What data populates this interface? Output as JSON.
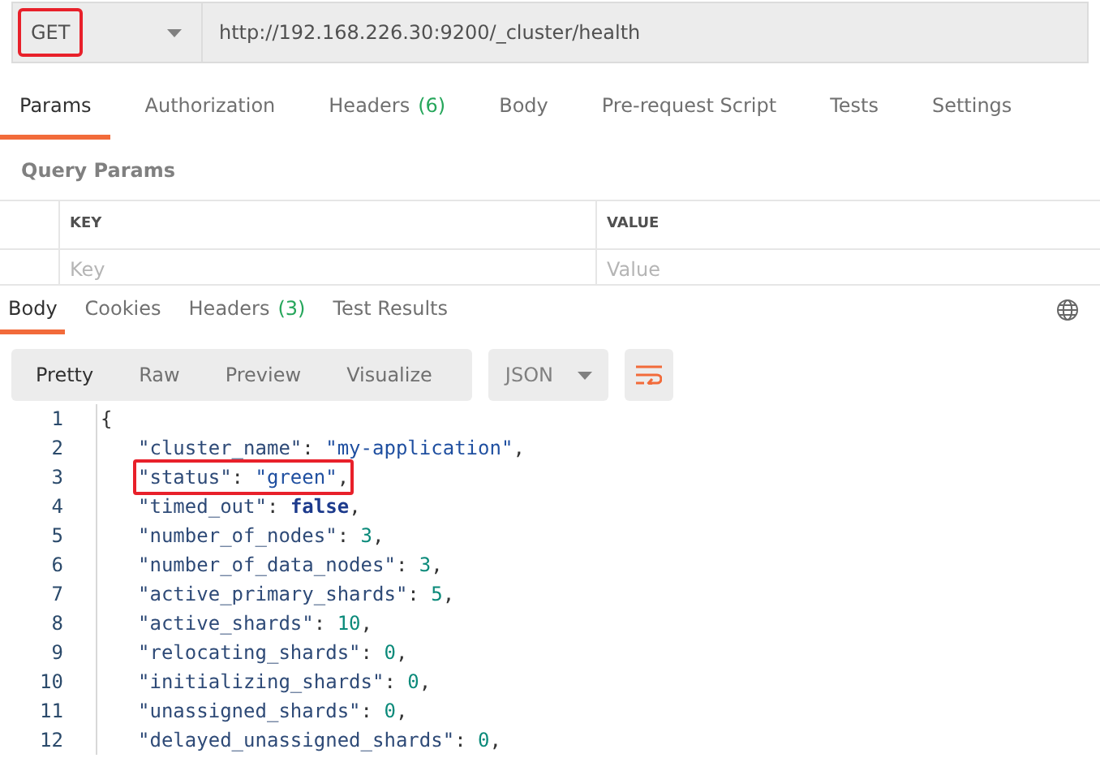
{
  "request": {
    "method": "GET",
    "method_highlighted": true,
    "url": "http://192.168.226.30:9200/_cluster/health"
  },
  "request_tabs": [
    {
      "label": "Params",
      "selected": true
    },
    {
      "label": "Authorization",
      "selected": false
    },
    {
      "label": "Headers",
      "count": "(6)",
      "selected": false
    },
    {
      "label": "Body",
      "selected": false
    },
    {
      "label": "Pre-request Script",
      "selected": false
    },
    {
      "label": "Tests",
      "selected": false
    },
    {
      "label": "Settings",
      "selected": false
    }
  ],
  "query_params": {
    "title": "Query Params",
    "columns": [
      "KEY",
      "VALUE"
    ],
    "placeholders": [
      "Key",
      "Value"
    ]
  },
  "response_tabs": [
    {
      "label": "Body",
      "selected": true
    },
    {
      "label": "Cookies",
      "selected": false
    },
    {
      "label": "Headers",
      "count": "(3)",
      "selected": false
    },
    {
      "label": "Test Results",
      "selected": false
    }
  ],
  "view_modes": [
    {
      "label": "Pretty",
      "selected": true
    },
    {
      "label": "Raw",
      "selected": false
    },
    {
      "label": "Preview",
      "selected": false
    },
    {
      "label": "Visualize",
      "selected": false
    }
  ],
  "format": "JSON",
  "code_lines": [
    {
      "number": "1",
      "highlighted": false,
      "indent": false,
      "tokens": [
        {
          "kind": "brace",
          "text": "{"
        }
      ]
    },
    {
      "number": "2",
      "highlighted": false,
      "indent": true,
      "tokens": [
        {
          "kind": "key",
          "text": "\"cluster_name\""
        },
        {
          "kind": "punct",
          "text": ": "
        },
        {
          "kind": "string",
          "text": "\"my-application\""
        },
        {
          "kind": "punct",
          "text": ","
        }
      ]
    },
    {
      "number": "3",
      "highlighted": true,
      "indent": true,
      "tokens": [
        {
          "kind": "key",
          "text": "\"status\""
        },
        {
          "kind": "punct",
          "text": ": "
        },
        {
          "kind": "string",
          "text": "\"green\""
        },
        {
          "kind": "punct",
          "text": ","
        }
      ]
    },
    {
      "number": "4",
      "highlighted": false,
      "indent": true,
      "tokens": [
        {
          "kind": "key",
          "text": "\"timed_out\""
        },
        {
          "kind": "punct",
          "text": ": "
        },
        {
          "kind": "boolean",
          "text": "false"
        },
        {
          "kind": "punct",
          "text": ","
        }
      ]
    },
    {
      "number": "5",
      "highlighted": false,
      "indent": true,
      "tokens": [
        {
          "kind": "key",
          "text": "\"number_of_nodes\""
        },
        {
          "kind": "punct",
          "text": ": "
        },
        {
          "kind": "number",
          "text": "3"
        },
        {
          "kind": "punct",
          "text": ","
        }
      ]
    },
    {
      "number": "6",
      "highlighted": false,
      "indent": true,
      "tokens": [
        {
          "kind": "key",
          "text": "\"number_of_data_nodes\""
        },
        {
          "kind": "punct",
          "text": ": "
        },
        {
          "kind": "number",
          "text": "3"
        },
        {
          "kind": "punct",
          "text": ","
        }
      ]
    },
    {
      "number": "7",
      "highlighted": false,
      "indent": true,
      "tokens": [
        {
          "kind": "key",
          "text": "\"active_primary_shards\""
        },
        {
          "kind": "punct",
          "text": ": "
        },
        {
          "kind": "number",
          "text": "5"
        },
        {
          "kind": "punct",
          "text": ","
        }
      ]
    },
    {
      "number": "8",
      "highlighted": false,
      "indent": true,
      "tokens": [
        {
          "kind": "key",
          "text": "\"active_shards\""
        },
        {
          "kind": "punct",
          "text": ": "
        },
        {
          "kind": "number",
          "text": "10"
        },
        {
          "kind": "punct",
          "text": ","
        }
      ]
    },
    {
      "number": "9",
      "highlighted": false,
      "indent": true,
      "tokens": [
        {
          "kind": "key",
          "text": "\"relocating_shards\""
        },
        {
          "kind": "punct",
          "text": ": "
        },
        {
          "kind": "number",
          "text": "0"
        },
        {
          "kind": "punct",
          "text": ","
        }
      ]
    },
    {
      "number": "10",
      "highlighted": false,
      "indent": true,
      "tokens": [
        {
          "kind": "key",
          "text": "\"initializing_shards\""
        },
        {
          "kind": "punct",
          "text": ": "
        },
        {
          "kind": "number",
          "text": "0"
        },
        {
          "kind": "punct",
          "text": ","
        }
      ]
    },
    {
      "number": "11",
      "highlighted": false,
      "indent": true,
      "tokens": [
        {
          "kind": "key",
          "text": "\"unassigned_shards\""
        },
        {
          "kind": "punct",
          "text": ": "
        },
        {
          "kind": "number",
          "text": "0"
        },
        {
          "kind": "punct",
          "text": ","
        }
      ]
    },
    {
      "number": "12",
      "highlighted": false,
      "indent": true,
      "tokens": [
        {
          "kind": "key",
          "text": "\"delayed_unassigned_shards\""
        },
        {
          "kind": "punct",
          "text": ": "
        },
        {
          "kind": "number",
          "text": "0"
        },
        {
          "kind": "punct",
          "text": ","
        }
      ]
    }
  ]
}
